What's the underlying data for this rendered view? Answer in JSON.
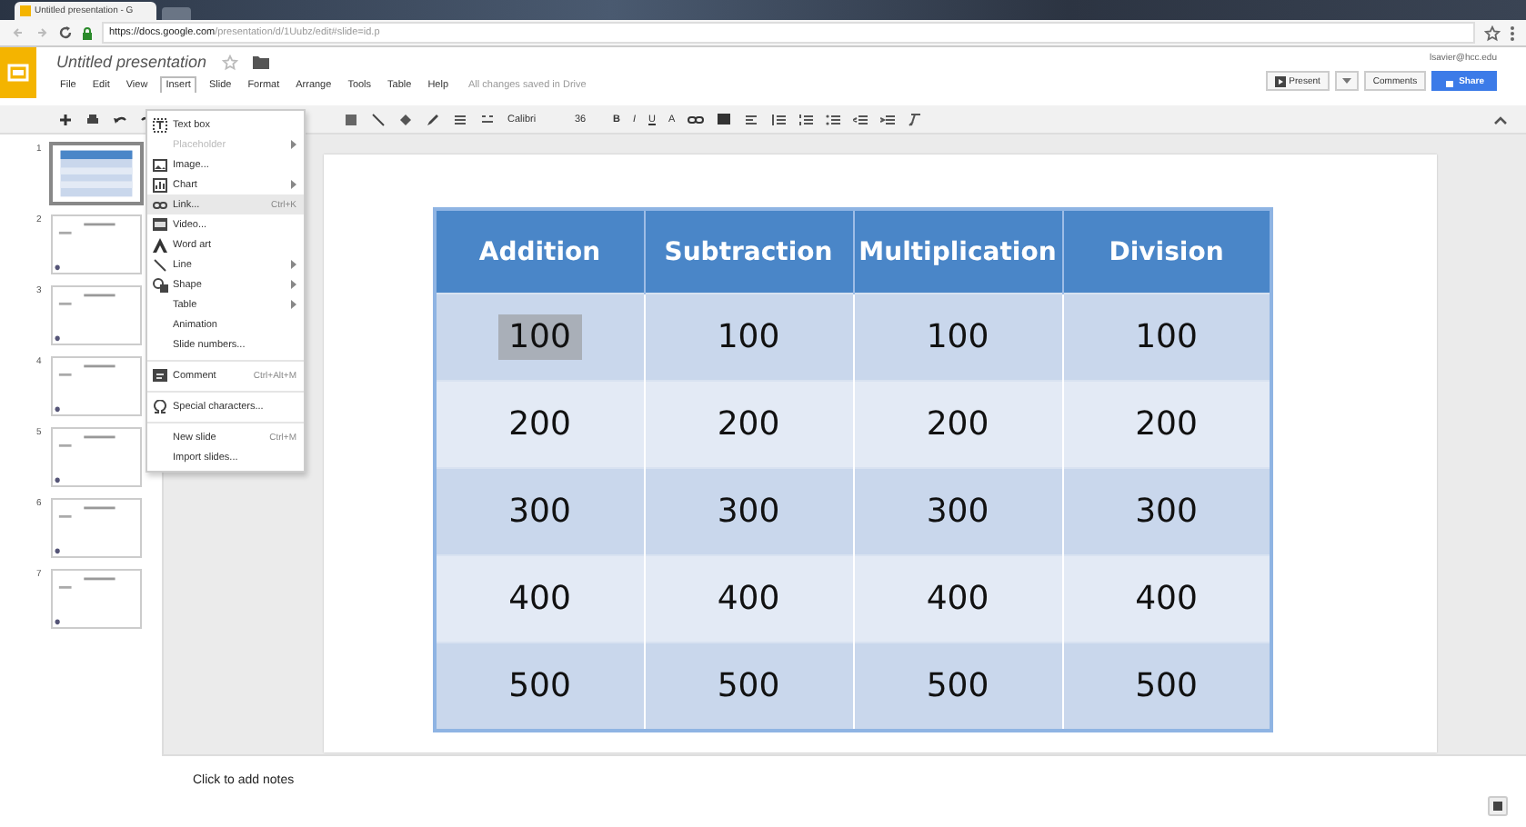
{
  "browser": {
    "tab_title": "Untitled presentation - G",
    "url_host": "https://docs.google.com",
    "url_path": "/presentation/d/1Uubz/edit#slide=id.p"
  },
  "app": {
    "title": "Untitled presentation",
    "account": "lsavier@hcc.edu",
    "save_status": "All changes saved in Drive",
    "menu": [
      {
        "label": "File",
        "selected": false
      },
      {
        "label": "Edit",
        "selected": false
      },
      {
        "label": "View",
        "selected": false
      },
      {
        "label": "Insert",
        "selected": true
      },
      {
        "label": "Slide",
        "selected": false
      },
      {
        "label": "Format",
        "selected": false
      },
      {
        "label": "Arrange",
        "selected": false
      },
      {
        "label": "Tools",
        "selected": false
      },
      {
        "label": "Table",
        "selected": false
      },
      {
        "label": "Help",
        "selected": false
      }
    ],
    "buttons": {
      "present": "Present",
      "comments": "Comments",
      "share": "Share"
    }
  },
  "toolbar": {
    "font": "Calibri",
    "font_size": "36",
    "format_buttons": [
      "B",
      "I",
      "U",
      "A"
    ]
  },
  "insert_menu": [
    {
      "kind": "textbox",
      "label": "Text box",
      "submenu": false,
      "disabled": false,
      "selected": false,
      "separator_before": false
    },
    {
      "kind": "none",
      "label": "Placeholder",
      "submenu": true,
      "disabled": true,
      "selected": false,
      "separator_before": false
    },
    {
      "kind": "image",
      "label": "Image...",
      "submenu": false,
      "disabled": false,
      "selected": false,
      "separator_before": false
    },
    {
      "kind": "chart",
      "label": "Chart",
      "submenu": true,
      "disabled": false,
      "selected": false,
      "separator_before": false
    },
    {
      "kind": "link",
      "label": "Link...",
      "shortcut": "Ctrl+K",
      "submenu": false,
      "disabled": false,
      "selected": true,
      "separator_before": false
    },
    {
      "kind": "video",
      "label": "Video...",
      "submenu": false,
      "disabled": false,
      "selected": false,
      "separator_before": false
    },
    {
      "kind": "wordart",
      "label": "Word art",
      "submenu": false,
      "disabled": false,
      "selected": false,
      "separator_before": false
    },
    {
      "kind": "line",
      "label": "Line",
      "submenu": true,
      "disabled": false,
      "selected": false,
      "separator_before": false
    },
    {
      "kind": "shape",
      "label": "Shape",
      "submenu": true,
      "disabled": false,
      "selected": false,
      "separator_before": false
    },
    {
      "kind": "none",
      "label": "Table",
      "submenu": true,
      "disabled": false,
      "selected": false,
      "separator_before": false
    },
    {
      "kind": "none",
      "label": "Animation",
      "submenu": false,
      "disabled": false,
      "selected": false,
      "separator_before": false
    },
    {
      "kind": "none",
      "label": "Slide numbers...",
      "submenu": false,
      "disabled": false,
      "selected": false,
      "separator_before": false
    },
    {
      "kind": "comment",
      "label": "Comment",
      "shortcut": "Ctrl+Alt+M",
      "submenu": false,
      "disabled": false,
      "selected": false,
      "separator_before": true
    },
    {
      "kind": "omega",
      "label": "Special characters...",
      "submenu": false,
      "disabled": false,
      "selected": false,
      "separator_before": true
    },
    {
      "kind": "none",
      "label": "New slide",
      "shortcut": "Ctrl+M",
      "submenu": false,
      "disabled": false,
      "selected": false,
      "separator_before": true
    },
    {
      "kind": "none",
      "label": "Import slides...",
      "submenu": false,
      "disabled": false,
      "selected": false,
      "separator_before": false
    }
  ],
  "slides": [
    {
      "number": "1",
      "selected": true
    },
    {
      "number": "2",
      "selected": false
    },
    {
      "number": "3",
      "selected": false
    },
    {
      "number": "4",
      "selected": false
    },
    {
      "number": "5",
      "selected": false
    },
    {
      "number": "6",
      "selected": false
    },
    {
      "number": "7",
      "selected": false
    }
  ],
  "table": {
    "columns": [
      "Addition",
      "Subtraction",
      "Multiplication",
      "Division"
    ],
    "rows": [
      [
        {
          "text": "100",
          "selected": true
        },
        {
          "text": "100",
          "selected": false
        },
        {
          "text": "100",
          "selected": false
        },
        {
          "text": "100",
          "selected": false
        }
      ],
      [
        {
          "text": "200",
          "selected": false
        },
        {
          "text": "200",
          "selected": false
        },
        {
          "text": "200",
          "selected": false
        },
        {
          "text": "200",
          "selected": false
        }
      ],
      [
        {
          "text": "300",
          "selected": false
        },
        {
          "text": "300",
          "selected": false
        },
        {
          "text": "300",
          "selected": false
        },
        {
          "text": "300",
          "selected": false
        }
      ],
      [
        {
          "text": "400",
          "selected": false
        },
        {
          "text": "400",
          "selected": false
        },
        {
          "text": "400",
          "selected": false
        },
        {
          "text": "400",
          "selected": false
        }
      ],
      [
        {
          "text": "500",
          "selected": false
        },
        {
          "text": "500",
          "selected": false
        },
        {
          "text": "500",
          "selected": false
        },
        {
          "text": "500",
          "selected": false
        }
      ]
    ]
  },
  "notes": {
    "placeholder": "Click to add notes"
  }
}
